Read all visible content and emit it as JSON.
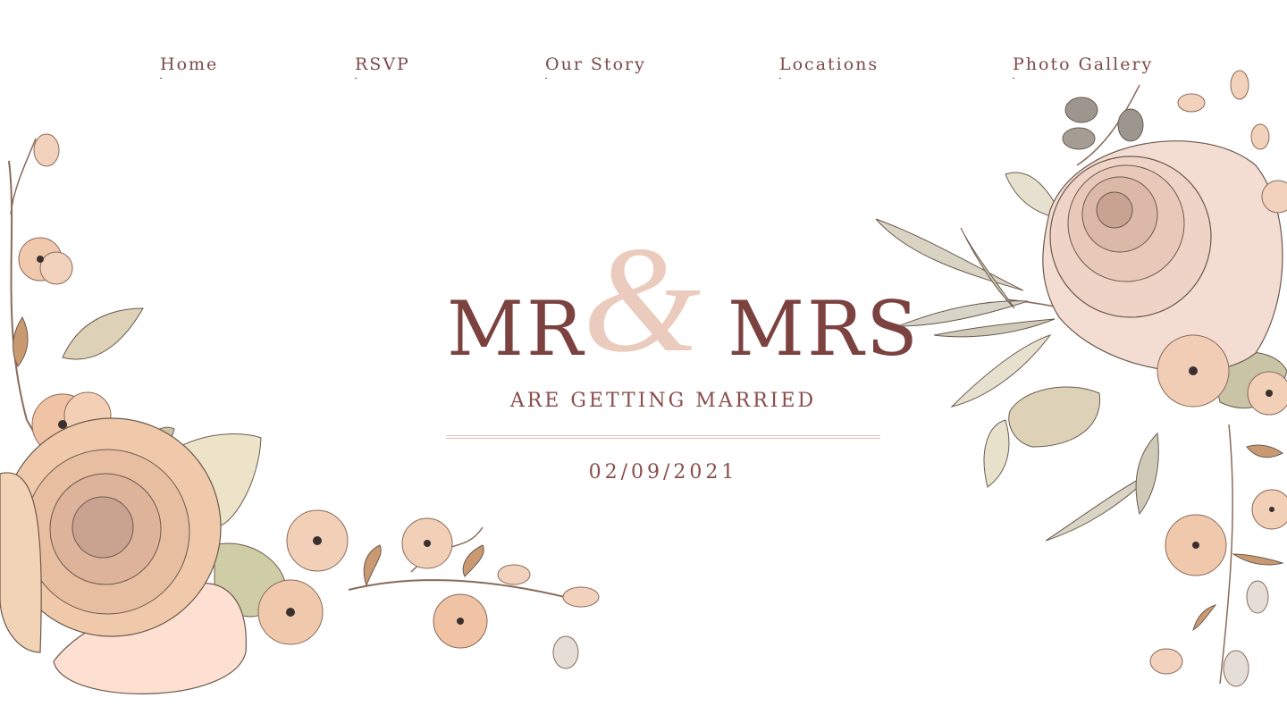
{
  "nav": {
    "items": [
      {
        "label": "Home"
      },
      {
        "label": "RSVP"
      },
      {
        "label": "Our Story"
      },
      {
        "label": "Locations"
      },
      {
        "label": "Photo Gallery"
      }
    ]
  },
  "hero": {
    "left_name": "MR",
    "ampersand": "&",
    "right_name": "MRS",
    "subtitle": "ARE GETTING MARRIED",
    "date": "02/09/2021"
  },
  "colors": {
    "text": "#7b4240",
    "ampersand": "#ebcbbd",
    "divider": "#e4c2b4",
    "petal_peach": "#f0c9ad",
    "petal_pink": "#f6d6c8",
    "leaf_sage": "#c9c4a6",
    "leaf_grey": "#9c968e",
    "stem": "#8a6a5a"
  },
  "icons": {
    "left_decoration": "floral-bouquet-left-icon",
    "right_decoration": "floral-bouquet-right-icon"
  }
}
